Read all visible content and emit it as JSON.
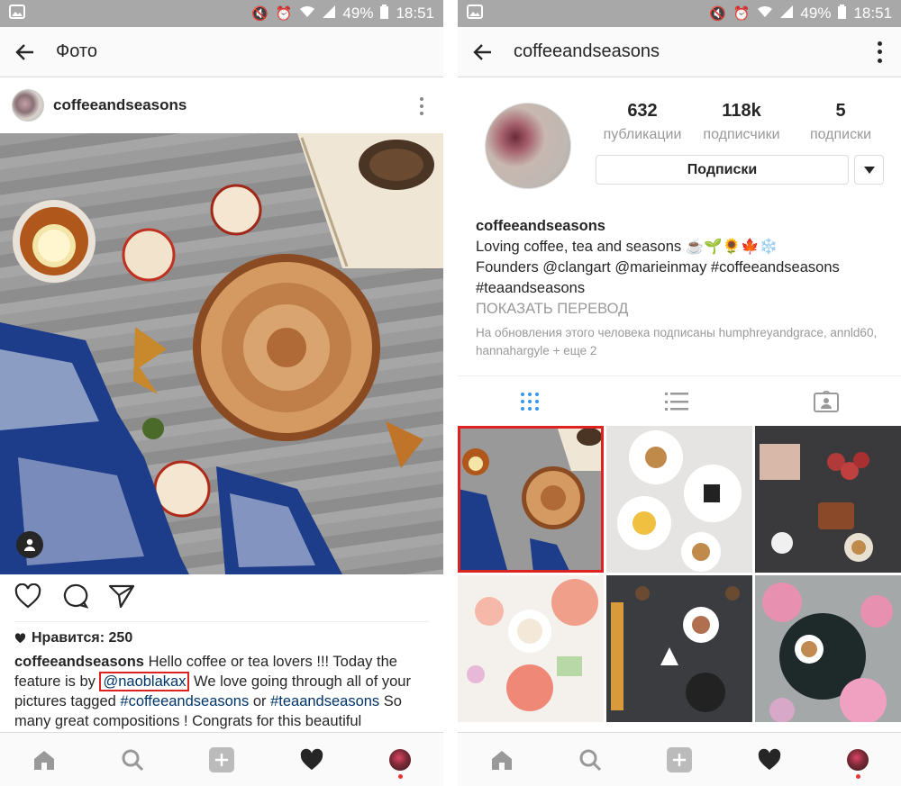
{
  "status_bar": {
    "battery": "49%",
    "time": "18:51"
  },
  "left_screen": {
    "app_bar": {
      "title": "Фото"
    },
    "post": {
      "username": "coffeeandseasons",
      "likes_label": "Нравится: 250",
      "caption": {
        "user": "coffeeandseasons",
        "text_1": " Hello coffee or tea lovers !!! Today the feature is by ",
        "mention": "@naoblakax",
        "text_2": " We love going through all of your pictures tagged ",
        "tag_1": "#coffeeandseasons",
        "text_3": " or ",
        "tag_2": "#teaandseasons",
        "text_4": "  So many great compositions !  Congrats  for this beautiful"
      }
    }
  },
  "right_screen": {
    "app_bar": {
      "title": "coffeeandseasons"
    },
    "stats": [
      {
        "value": "632",
        "label": "публикации"
      },
      {
        "value": "118k",
        "label": "подписчики"
      },
      {
        "value": "5",
        "label": "подписки"
      }
    ],
    "follow_button": "Подписки",
    "bio": {
      "name": "coffeeandseasons",
      "line_1": "Loving coffee, tea and seasons ☕🌱🌻🍁❄️",
      "line_2": "Founders @clangart @marieinmay #coffeeandseasons",
      "line_3": "#teaandseasons",
      "translate": "ПОКАЗАТЬ ПЕРЕВОД"
    },
    "followed_by": "На обновления этого человека подписаны humphreyandgrace, annld60, hannahargyle + еще 2"
  },
  "colors": {
    "status_bar": "#a8a8a8",
    "link": "#003569",
    "highlight": "#dd2222",
    "muted": "#999999"
  }
}
